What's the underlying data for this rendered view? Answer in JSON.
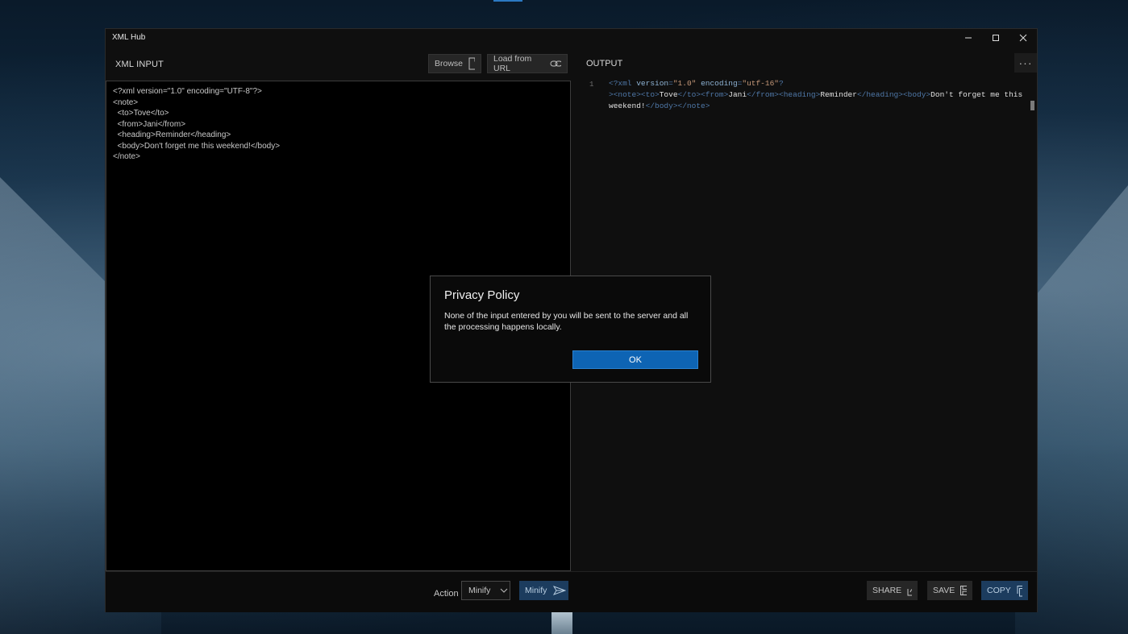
{
  "window": {
    "title": "XML Hub",
    "controls": {
      "minimize": "—",
      "maximize": "☐",
      "close": "✕"
    }
  },
  "input": {
    "header": "XML INPUT",
    "browse_label": "Browse",
    "load_url_label": "Load from URL",
    "text": "<?xml version=\"1.0\" encoding=\"UTF-8\"?>\n<note>\n  <to>Tove</to>\n  <from>Jani</from>\n  <heading>Reminder</heading>\n  <body>Don't forget me this weekend!</body>\n</note>"
  },
  "output": {
    "header": "OUTPUT",
    "more_label": "···",
    "line_number": "1",
    "segments": [
      {
        "t": "<?xml ",
        "c": "tag"
      },
      {
        "t": "version",
        "c": "attr"
      },
      {
        "t": "=",
        "c": "tag"
      },
      {
        "t": "\"1.0\"",
        "c": "str"
      },
      {
        "t": " ",
        "c": ""
      },
      {
        "t": "encoding",
        "c": "attr"
      },
      {
        "t": "=",
        "c": "tag"
      },
      {
        "t": "\"utf-16\"",
        "c": "str"
      },
      {
        "t": "?\n>",
        "c": "tag"
      },
      {
        "t": "<note>",
        "c": "tag"
      },
      {
        "t": "<to>",
        "c": "tag"
      },
      {
        "t": "Tove",
        "c": ""
      },
      {
        "t": "</to>",
        "c": "tag"
      },
      {
        "t": "<from>",
        "c": "tag"
      },
      {
        "t": "Jani",
        "c": ""
      },
      {
        "t": "</from>",
        "c": "tag"
      },
      {
        "t": "<heading>",
        "c": "tag"
      },
      {
        "t": "Reminder",
        "c": ""
      },
      {
        "t": "</heading>",
        "c": "tag"
      },
      {
        "t": "<body>",
        "c": "tag"
      },
      {
        "t": "Don't forget me this\nweekend!",
        "c": ""
      },
      {
        "t": "</body>",
        "c": "tag"
      },
      {
        "t": "</note>",
        "c": "tag"
      }
    ]
  },
  "bottom": {
    "action_label": "Action",
    "select_value": "Minify",
    "run_label": "Minify",
    "share_label": "SHARE",
    "save_label": "SAVE",
    "copy_label": "COPY"
  },
  "dialog": {
    "title": "Privacy Policy",
    "body": "None of the input entered by you will be sent to the server and all the processing happens locally.",
    "ok_label": "OK"
  },
  "colors": {
    "accent": "#0e64b4",
    "accent_dark": "#1c3c5e",
    "window_bg": "#0f0f0f"
  }
}
